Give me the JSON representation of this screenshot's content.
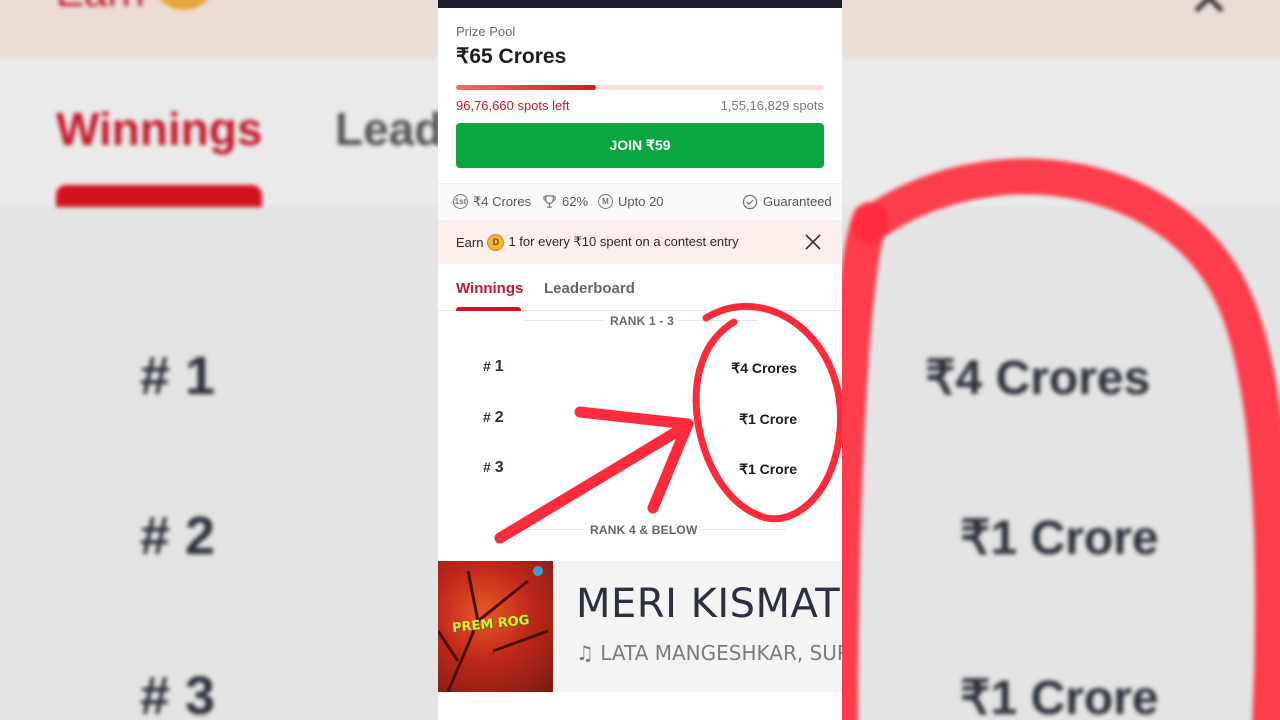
{
  "background": {
    "earn_text": "Earn",
    "tab_active": "Winnings",
    "tab_other": "Leade",
    "ranks": [
      "# 1",
      "# 2",
      "# 3"
    ],
    "amounts": [
      "₹4 Crores",
      "₹1 Crore",
      "₹1 Crore"
    ]
  },
  "contest": {
    "prize_label": "Prize Pool",
    "prize_amount": "₹65 Crores",
    "spots_left": "96,76,660 spots left",
    "total_spots": "1,55,16,829 spots",
    "filled_percent": 38,
    "join_label": "JOIN ₹59"
  },
  "info": {
    "first_prize": "₹4 Crores",
    "win_percent": "62%",
    "max_entries": "Upto 20",
    "guaranteed": "Guaranteed",
    "first_icon": "1st",
    "multi_icon": "M"
  },
  "earn_banner": {
    "prefix": "Earn",
    "coin_glyph": "D",
    "text": "1 for every ₹10 spent on a contest entry"
  },
  "tabs": {
    "winnings": "Winnings",
    "leaderboard": "Leaderboard"
  },
  "winnings": {
    "section1_label": "RANK 1 - 3",
    "rows": [
      {
        "hash": "#",
        "rank": "1",
        "amount": "₹4 Crores"
      },
      {
        "hash": "#",
        "rank": "2",
        "amount": "₹1 Crore"
      },
      {
        "hash": "#",
        "rank": "3",
        "amount": "₹1 Crore"
      }
    ],
    "section2_label": "RANK 4 & BELOW"
  },
  "ad": {
    "art_text": "PREM ROG",
    "title": "MERI KISMAT M",
    "subtitle": "LATA MANGESHKAR, SURES"
  },
  "colors": {
    "accent_red": "#d4121e",
    "join_green": "#0ba641",
    "annotation_red": "#ff2a3a"
  }
}
